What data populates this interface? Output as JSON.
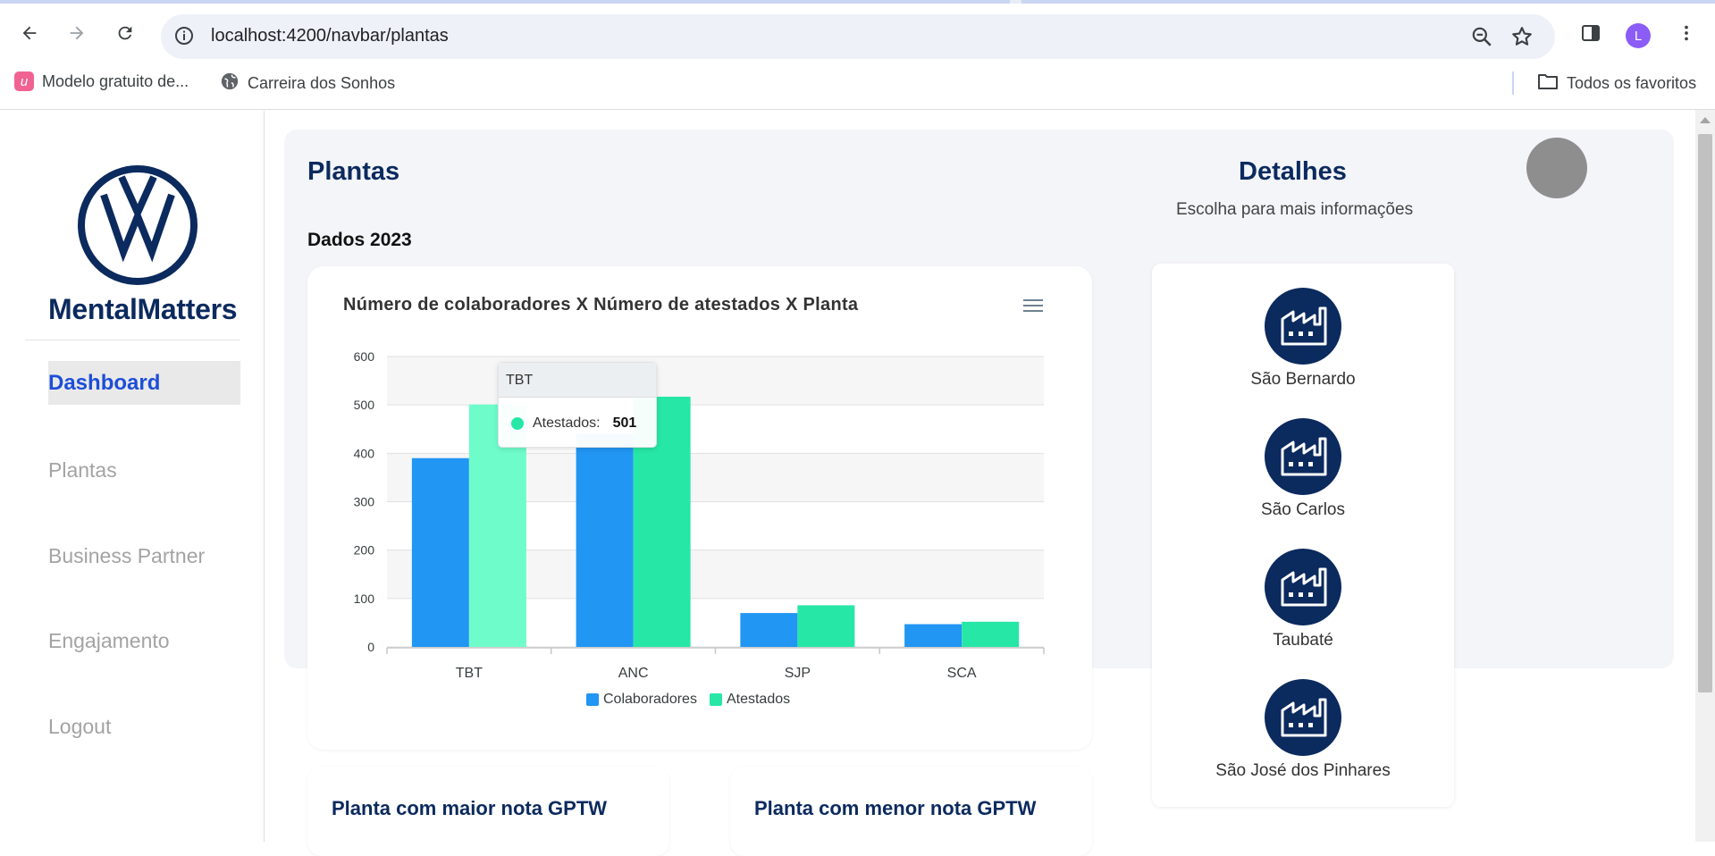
{
  "browser": {
    "url": "localhost:4200/navbar/plantas",
    "profile_initial": "L",
    "bookmarks": [
      {
        "label": "Modelo gratuito de...",
        "icon": "u-logo-icon"
      },
      {
        "label": "Carreira dos Sonhos",
        "icon": "globe-icon"
      }
    ],
    "all_bookmarks_label": "Todos os favoritos"
  },
  "sidebar": {
    "brand": "MentalMatters",
    "items": [
      {
        "label": "Dashboard",
        "active": true
      },
      {
        "label": "Plantas"
      },
      {
        "label": "Business Partner"
      },
      {
        "label": "Engajamento"
      },
      {
        "label": "Logout"
      }
    ]
  },
  "main": {
    "title": "Plantas",
    "subtitle": "Dados 2023",
    "best_gptw": "Planta com maior nota GPTW",
    "worst_gptw": "Planta com menor nota GPTW"
  },
  "chart_data": {
    "type": "bar",
    "title": "Número de colaboradores X Número de atestados X Planta",
    "categories": [
      "TBT",
      "ANC",
      "SJP",
      "SCA"
    ],
    "series": [
      {
        "name": "Colaboradores",
        "color": "#2196f3",
        "values": [
          390,
          440,
          70,
          47
        ]
      },
      {
        "name": "Atestados",
        "color": "#26e7a6",
        "values": [
          501,
          517,
          86,
          52
        ]
      }
    ],
    "ylim": [
      0,
      600
    ],
    "yticks": [
      "0",
      "100",
      "200",
      "300",
      "400",
      "500",
      "600"
    ],
    "legend": "bottom",
    "grid": true,
    "hover_index": 0
  },
  "tooltip": {
    "category": "TBT",
    "series": "Atestados:",
    "value": "501"
  },
  "details": {
    "title": "Detalhes",
    "subtitle": "Escolha para mais informações",
    "plants": [
      "São Bernardo",
      "São Carlos",
      "Taubaté",
      "São José dos Pinhares"
    ]
  }
}
